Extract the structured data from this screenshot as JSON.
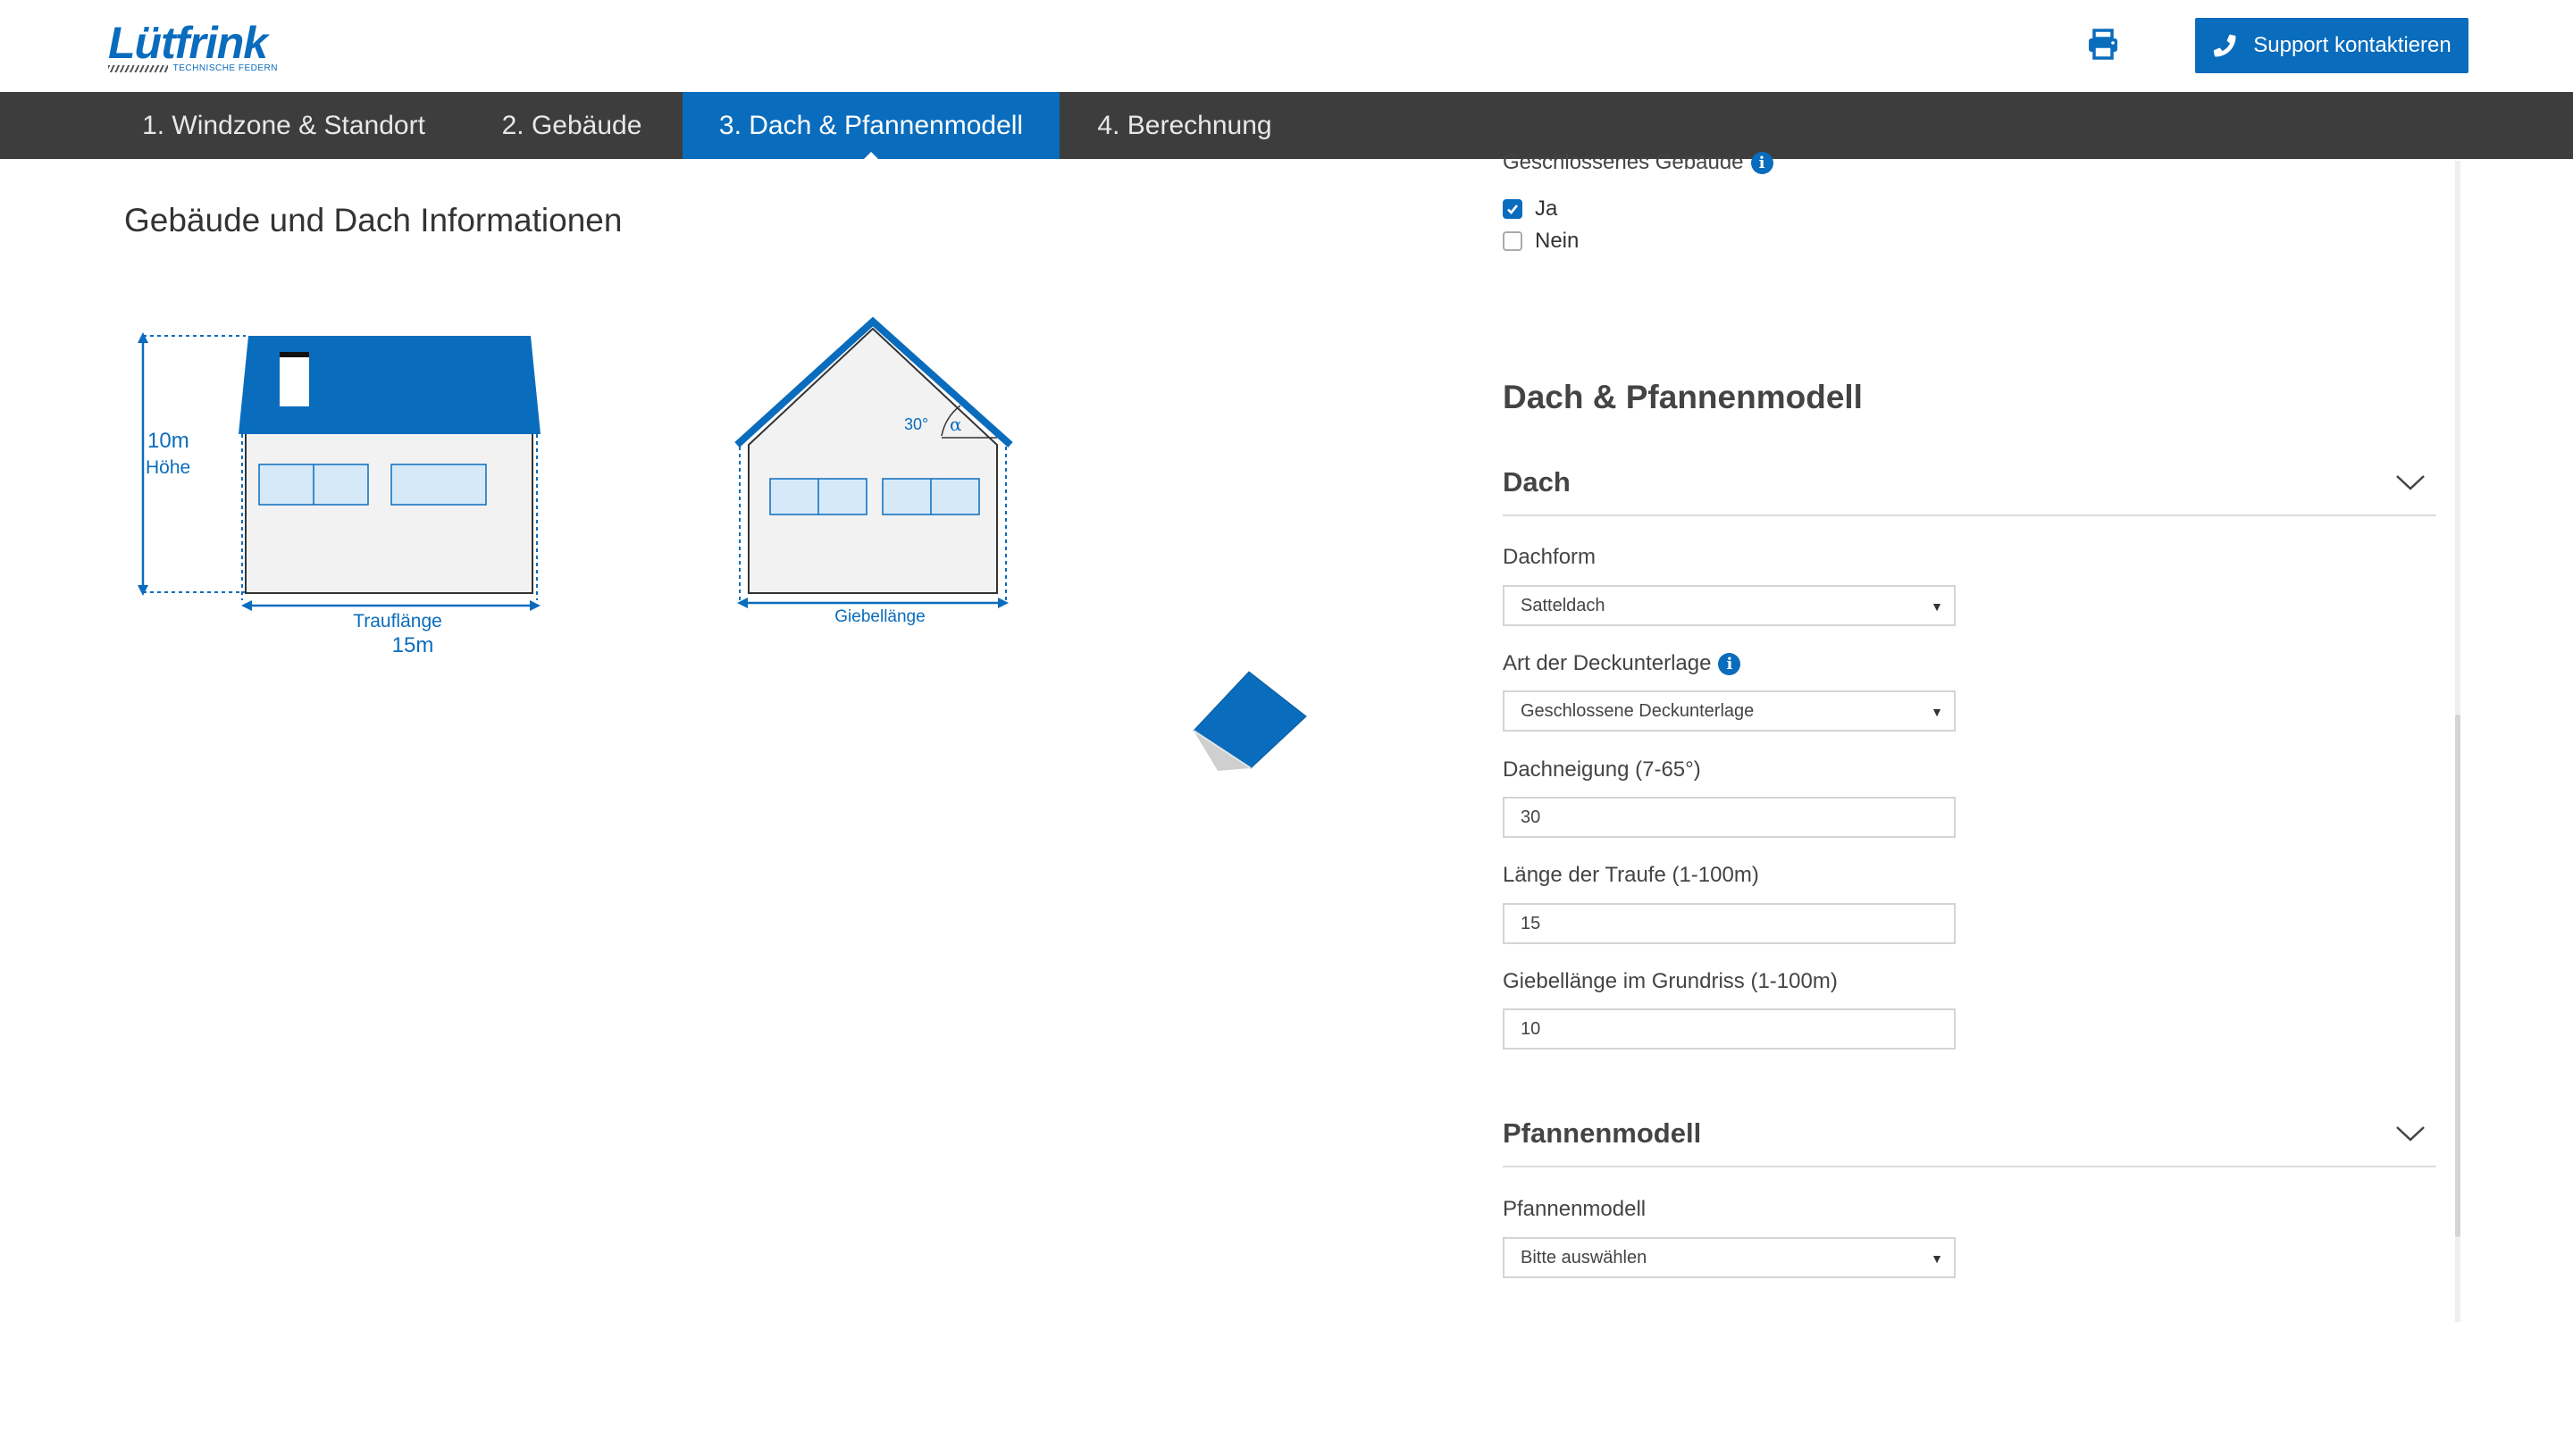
{
  "header": {
    "logo_text": "Lütfrink",
    "logo_tagline": "TECHNISCHE FEDERN",
    "support_label": "Support kontaktieren",
    "print_icon": "printer-icon",
    "phone_icon": "phone-icon"
  },
  "nav": {
    "tabs": [
      {
        "label": "1. Windzone & Standort",
        "active": false
      },
      {
        "label": "2. Gebäude",
        "active": false
      },
      {
        "label": "3. Dach & Pfannenmodell",
        "active": true
      },
      {
        "label": "4. Berechnung",
        "active": false
      }
    ]
  },
  "left": {
    "section_title": "Gebäude und Dach Informationen",
    "height_value": "10m",
    "height_label": "Höhe",
    "eave_label": "Trauflänge",
    "eave_value": "15m",
    "angle_value": "30°",
    "angle_symbol": "α",
    "gable_label": "Giebellänge"
  },
  "right": {
    "closed_building": {
      "label": "Geschlossenes Gebäude",
      "options": [
        {
          "label": "Ja",
          "checked": true
        },
        {
          "label": "Nein",
          "checked": false
        }
      ]
    },
    "roof_section_title": "Dach & Pfannenmodell",
    "roof_accordion": {
      "title": "Dach",
      "dachform_label": "Dachform",
      "dachform_value": "Satteldach",
      "underlay_label": "Art der Deckunterlage",
      "underlay_value": "Geschlossene Deckunterlage",
      "pitch_label": "Dachneigung (7-65°)",
      "pitch_value": "30",
      "eave_length_label": "Länge der Traufe (1-100m)",
      "eave_length_value": "15",
      "gable_length_label": "Giebellänge im Grundriss (1-100m)",
      "gable_length_value": "10"
    },
    "tile_accordion": {
      "title": "Pfannenmodell",
      "model_label": "Pfannenmodell",
      "model_value": "Bitte auswählen"
    }
  },
  "colors": {
    "brand_blue": "#0a6cbd",
    "nav_bg": "#3d3d3d"
  }
}
